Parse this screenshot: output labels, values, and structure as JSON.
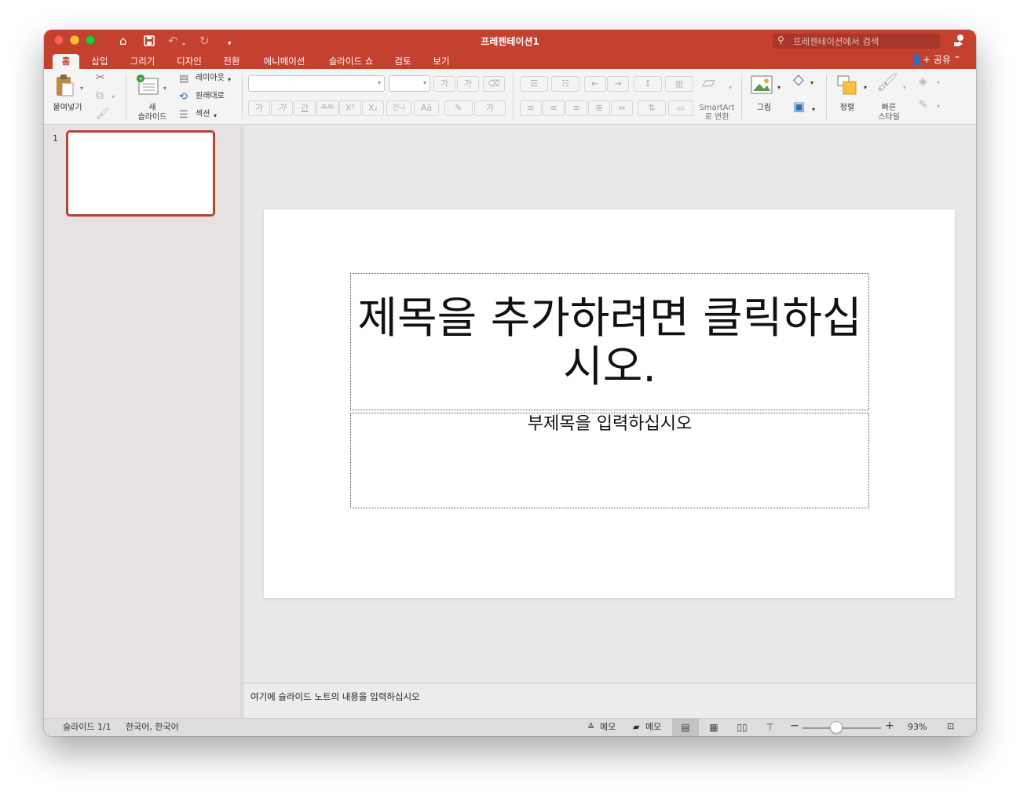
{
  "window": {
    "title": "프레젠테이션1",
    "search_placeholder": "프레젠테이션에서 검색"
  },
  "tabs": [
    {
      "label": "홈",
      "active": true
    },
    {
      "label": "삽입"
    },
    {
      "label": "그리기"
    },
    {
      "label": "디자인"
    },
    {
      "label": "전환"
    },
    {
      "label": "애니메이션"
    },
    {
      "label": "슬라이드 쇼"
    },
    {
      "label": "검토"
    },
    {
      "label": "보기"
    }
  ],
  "share_label": "공유",
  "ribbon": {
    "paste": "붙여넣기",
    "new_slide_line1": "새",
    "new_slide_line2": "슬라이드",
    "layout": "레이아웃",
    "reset": "원래대로",
    "section": "섹션",
    "smartart_line1": "SmartArt",
    "smartart_line2": "로 변환",
    "picture": "그림",
    "arrange": "정렬",
    "quick_styles_line1": "빠른",
    "quick_styles_line2": "스타일",
    "font_grow": "가",
    "font_shrink": "가",
    "bold": "가",
    "italic": "가",
    "underline": "간",
    "strike": "ᄎᄐᄐ",
    "superscript": "X²",
    "subscript": "X₂",
    "spacing": "간나",
    "case": "Aā",
    "font_color": "가"
  },
  "slides_panel": {
    "slide_number": "1"
  },
  "slide": {
    "title_placeholder": "제목을 추가하려면 클릭하십시오.",
    "subtitle_placeholder": "부제목을 입력하십시오"
  },
  "notes_placeholder": "여기에 슬라이드 노트의 내용을 입력하십시오",
  "status": {
    "slide_indicator": "슬라이드 1/1",
    "language": "한국어, 한국어",
    "notes_button": "메모",
    "comments_button": "메모",
    "zoom": "93%",
    "zoom_level": 0.43
  },
  "colors": {
    "accent": "#c4402f",
    "ribbon_bg": "#f5f4f4"
  }
}
